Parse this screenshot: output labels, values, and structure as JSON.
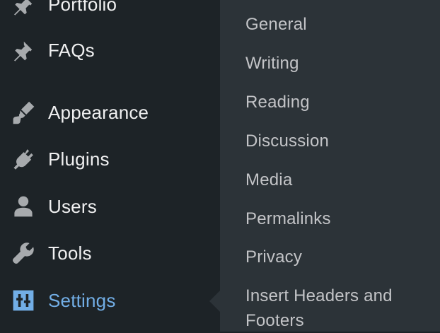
{
  "sidebar": {
    "items": [
      {
        "label": "Portfolio",
        "icon": "pin-icon"
      },
      {
        "label": "FAQs",
        "icon": "pin-icon"
      },
      {
        "label": "Appearance",
        "icon": "paintbrush-icon"
      },
      {
        "label": "Plugins",
        "icon": "plug-icon"
      },
      {
        "label": "Users",
        "icon": "user-icon"
      },
      {
        "label": "Tools",
        "icon": "wrench-icon"
      },
      {
        "label": "Settings",
        "icon": "settings-sliders-icon"
      }
    ],
    "current": "Settings"
  },
  "submenu": {
    "items": [
      {
        "label": "General"
      },
      {
        "label": "Writing"
      },
      {
        "label": "Reading"
      },
      {
        "label": "Discussion"
      },
      {
        "label": "Media"
      },
      {
        "label": "Permalinks"
      },
      {
        "label": "Privacy"
      },
      {
        "label": "Insert Headers and"
      },
      {
        "label": "Footers"
      }
    ]
  },
  "colors": {
    "sidebar_bg": "#1d2327",
    "submenu_bg": "#2c3338",
    "accent": "#72aee6",
    "text": "#f0f0f1",
    "icon": "#a7aaad",
    "submenu_text": "#c3c4c7"
  }
}
